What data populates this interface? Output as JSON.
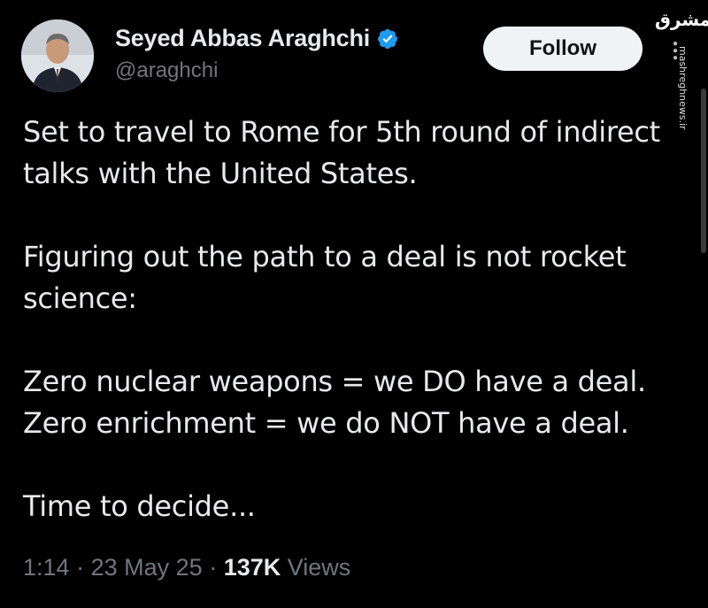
{
  "author": {
    "display_name": "Seyed Abbas Araghchi",
    "handle": "@araghchi",
    "verified": true,
    "verified_color": "#1d9bf0"
  },
  "follow_button": {
    "label": "Follow"
  },
  "tweet": {
    "paragraphs": [
      "Set to travel to Rome for 5th round of indirect talks with the United States.",
      "Figuring out the path to a deal is not rocket science:",
      "Zero nuclear weapons = we DO have a deal.\nZero enrichment = we do NOT have a deal.",
      "Time to decide..."
    ]
  },
  "meta": {
    "time": "1:14",
    "separator": "·",
    "date": "23 May 25",
    "views_count": "137K",
    "views_label": "Views"
  },
  "watermark": {
    "logo": "مشرق",
    "site": "mashreghnews.ir"
  },
  "colors": {
    "background": "#000000",
    "text": "#e7e9ea",
    "secondary": "#71767b",
    "button_bg": "#eff3f4"
  }
}
